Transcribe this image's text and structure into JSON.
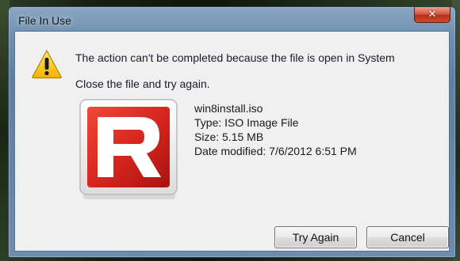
{
  "window": {
    "title": "File In Use",
    "close_label": "✕"
  },
  "message": {
    "main": "The action can't be completed because the file is open in System",
    "sub": "Close the file and try again.",
    "icon": "warning-icon"
  },
  "file": {
    "icon": "file-type-r-logo-icon",
    "name": "win8install.iso",
    "type": "Type: ISO Image File",
    "size": "Size: 5.15 MB",
    "modified": "Date modified: 7/6/2012 6:51 PM"
  },
  "buttons": {
    "try_again": "Try Again",
    "cancel": "Cancel"
  },
  "colors": {
    "logo_red": "#d7261e",
    "warning_yellow": "#f2c200",
    "close_red": "#c7432a"
  }
}
